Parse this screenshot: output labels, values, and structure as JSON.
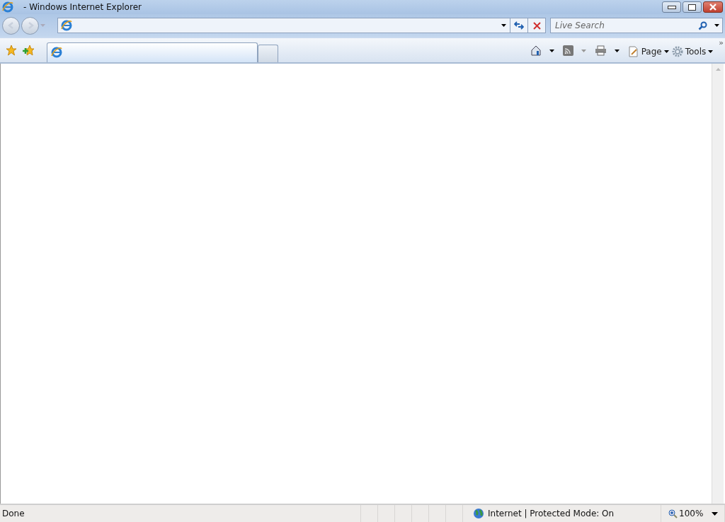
{
  "window": {
    "title": "- Windows Internet Explorer"
  },
  "search": {
    "placeholder": "Live Search"
  },
  "tabs": [
    {
      "selected": true
    },
    {
      "selected": false
    }
  ],
  "command_bar": {
    "page": "Page",
    "tools": "Tools",
    "overflow": "»"
  },
  "status_bar": {
    "status": "Done",
    "zone": "Internet | Protected Mode: On",
    "zoom": "100%"
  }
}
